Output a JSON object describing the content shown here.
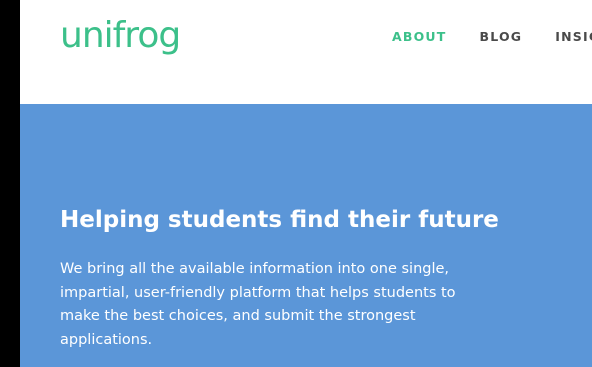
{
  "header": {
    "logo_text": "unifrog",
    "nav": [
      {
        "label": "ABOUT",
        "active": true
      },
      {
        "label": "BLOG",
        "active": false
      },
      {
        "label": "INSIG",
        "active": false
      }
    ]
  },
  "hero": {
    "title": "Helping students find their future",
    "lines": [
      "We bring all the available information into one single,",
      "impartial, user-friendly platform that helps students to",
      "make the best choices, and submit the strongest",
      "applications."
    ]
  },
  "colors": {
    "brand_green": "#3cc08a",
    "hero_blue": "#5b96d8",
    "nav_text": "#4a4a4a",
    "page_edge": "#000000"
  }
}
